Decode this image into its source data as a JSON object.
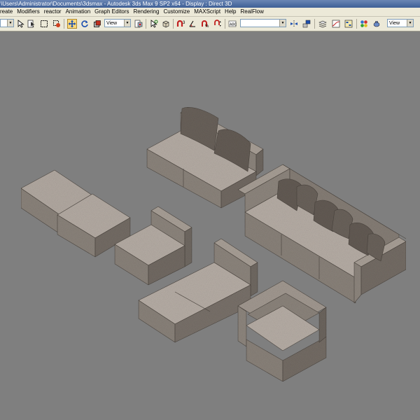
{
  "window": {
    "title": "\\Users\\Administrator\\Documents\\3dsmax    -  Autodesk 3ds Max 9 SP2 x64     -  Display : Direct 3D"
  },
  "menubar": {
    "items": [
      {
        "label": "reate"
      },
      {
        "label": "Modifiers"
      },
      {
        "label": "reactor"
      },
      {
        "label": "Animation"
      },
      {
        "label": "Graph Editors"
      },
      {
        "label": "Rendering"
      },
      {
        "label": "Customize"
      },
      {
        "label": "MAXScript"
      },
      {
        "label": "Help"
      },
      {
        "label": "RealFlow"
      }
    ]
  },
  "toolbar": {
    "reference_coord": "View",
    "named_selection": "",
    "view_select": "View",
    "active_tool": "select-and-move"
  },
  "colors": {
    "viewport_bg": "#7f7f7f",
    "fabric_top": "#b5aca4",
    "fabric_side": "#8d857d",
    "fabric_dark": "#5e5750",
    "cushion": "#6d655e"
  }
}
